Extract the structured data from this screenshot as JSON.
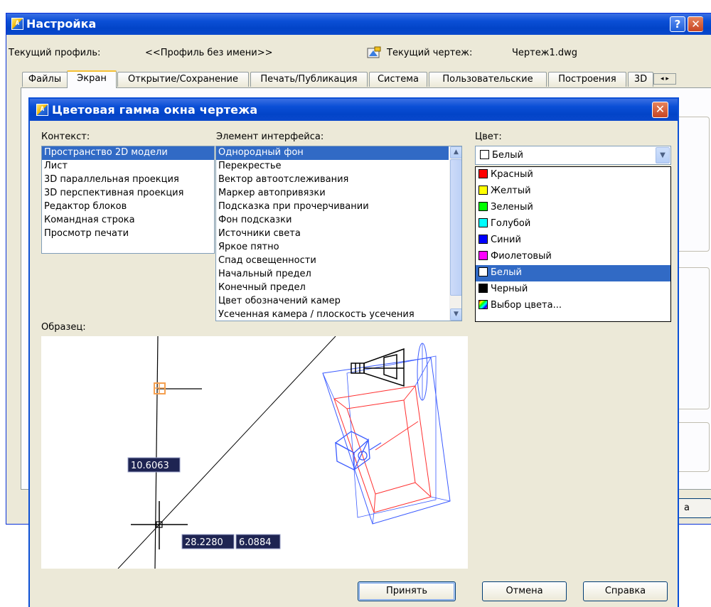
{
  "outer": {
    "title": "Настройка",
    "help_label": "?",
    "close_label": "✕",
    "icon_label": "A",
    "profile_label": "Текущий профиль:",
    "profile_value": "<<Профиль без имени>>",
    "drawing_label": "Текущий чертеж:",
    "drawing_value": "Чертеж1.dwg",
    "tabs": [
      "Файлы",
      "Экран",
      "Открытие/Сохранение",
      "Печать/Публикация",
      "Система",
      "Пользовательские",
      "Построения",
      "3D"
    ],
    "active_tab": "Экран",
    "tab_scroll": "◂ ▸",
    "ok_fragment": "а"
  },
  "dialog": {
    "title": "Цветовая гамма окна чертежа",
    "close_label": "✕",
    "icon_label": "A",
    "context_label": "Контекст:",
    "context_items": [
      "Пространство 2D модели",
      "Лист",
      "3D параллельная проекция",
      "3D перспективная проекция",
      "Редактор блоков",
      "Командная строка",
      "Просмотр печати"
    ],
    "context_selected": "Пространство 2D модели",
    "element_label": "Элемент интерфейса:",
    "element_items": [
      "Однородный фон",
      "Перекрестье",
      "Вектор автоотслеживания",
      "Маркер автопривязки",
      "Подсказка при прочерчивании",
      "Фон подсказки",
      "Источники света",
      "Яркое пятно",
      "Спад освещенности",
      "Начальный предел",
      "Конечный предел",
      "Цвет обозначений камер",
      "Усеченная камера / плоскость усечения"
    ],
    "element_selected": "Однородный фон",
    "color_label": "Цвет:",
    "color_value": "Белый",
    "color_value_swatch": "#ffffff",
    "color_options": [
      {
        "label": "Красный",
        "swatch": "#ff0000"
      },
      {
        "label": "Желтый",
        "swatch": "#ffff00"
      },
      {
        "label": "Зеленый",
        "swatch": "#00ff00"
      },
      {
        "label": "Голубой",
        "swatch": "#00ffff"
      },
      {
        "label": "Синий",
        "swatch": "#0000ff"
      },
      {
        "label": "Фиолетовый",
        "swatch": "#ff00ff"
      },
      {
        "label": "Белый",
        "swatch": "#ffffff"
      },
      {
        "label": "Черный",
        "swatch": "#000000"
      },
      {
        "label": "Выбор цвета...",
        "swatch": "rainbow"
      }
    ],
    "color_option_selected": "Белый",
    "sample_label": "Образец:",
    "preview": {
      "tooltip_1": "10.6063",
      "tooltip_2": "28.2280",
      "tooltip_3": "6.0884"
    },
    "buttons": {
      "accept": "Принять",
      "cancel": "Отмена",
      "help": "Справка"
    }
  },
  "colors": {
    "title_bar": "#0b4fd6",
    "selection": "#316ac5",
    "dialog_bg": "#ece9d8",
    "tooltip_bg": "#1e2452",
    "snap_marker": "#f5a050",
    "camera_blue": "#3b5bff",
    "clip_red": "#ff3030"
  }
}
